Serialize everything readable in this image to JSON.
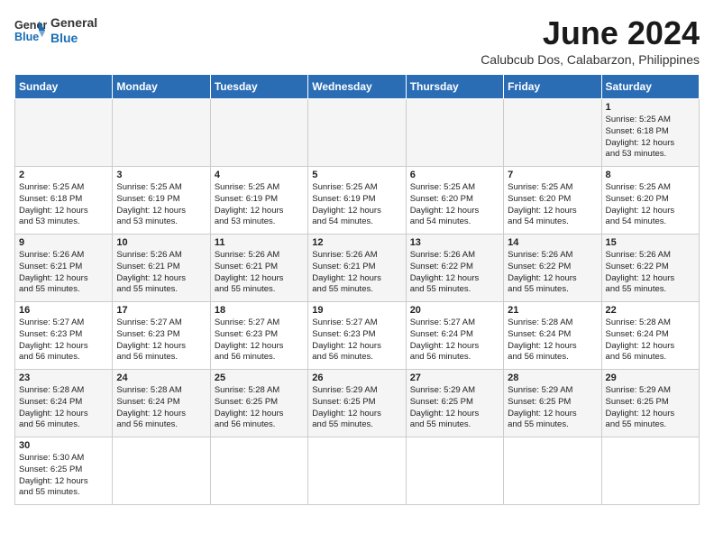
{
  "logo": {
    "text_general": "General",
    "text_blue": "Blue"
  },
  "title": "June 2024",
  "location": "Calubcub Dos, Calabarzon, Philippines",
  "days_of_week": [
    "Sunday",
    "Monday",
    "Tuesday",
    "Wednesday",
    "Thursday",
    "Friday",
    "Saturday"
  ],
  "weeks": [
    [
      {
        "day": "",
        "info": ""
      },
      {
        "day": "",
        "info": ""
      },
      {
        "day": "",
        "info": ""
      },
      {
        "day": "",
        "info": ""
      },
      {
        "day": "",
        "info": ""
      },
      {
        "day": "",
        "info": ""
      },
      {
        "day": "1",
        "info": "Sunrise: 5:25 AM\nSunset: 6:18 PM\nDaylight: 12 hours\nand 53 minutes."
      }
    ],
    [
      {
        "day": "2",
        "info": "Sunrise: 5:25 AM\nSunset: 6:18 PM\nDaylight: 12 hours\nand 53 minutes."
      },
      {
        "day": "3",
        "info": "Sunrise: 5:25 AM\nSunset: 6:19 PM\nDaylight: 12 hours\nand 53 minutes."
      },
      {
        "day": "4",
        "info": "Sunrise: 5:25 AM\nSunset: 6:19 PM\nDaylight: 12 hours\nand 53 minutes."
      },
      {
        "day": "5",
        "info": "Sunrise: 5:25 AM\nSunset: 6:19 PM\nDaylight: 12 hours\nand 54 minutes."
      },
      {
        "day": "6",
        "info": "Sunrise: 5:25 AM\nSunset: 6:20 PM\nDaylight: 12 hours\nand 54 minutes."
      },
      {
        "day": "7",
        "info": "Sunrise: 5:25 AM\nSunset: 6:20 PM\nDaylight: 12 hours\nand 54 minutes."
      },
      {
        "day": "8",
        "info": "Sunrise: 5:25 AM\nSunset: 6:20 PM\nDaylight: 12 hours\nand 54 minutes."
      }
    ],
    [
      {
        "day": "9",
        "info": "Sunrise: 5:26 AM\nSunset: 6:21 PM\nDaylight: 12 hours\nand 55 minutes."
      },
      {
        "day": "10",
        "info": "Sunrise: 5:26 AM\nSunset: 6:21 PM\nDaylight: 12 hours\nand 55 minutes."
      },
      {
        "day": "11",
        "info": "Sunrise: 5:26 AM\nSunset: 6:21 PM\nDaylight: 12 hours\nand 55 minutes."
      },
      {
        "day": "12",
        "info": "Sunrise: 5:26 AM\nSunset: 6:21 PM\nDaylight: 12 hours\nand 55 minutes."
      },
      {
        "day": "13",
        "info": "Sunrise: 5:26 AM\nSunset: 6:22 PM\nDaylight: 12 hours\nand 55 minutes."
      },
      {
        "day": "14",
        "info": "Sunrise: 5:26 AM\nSunset: 6:22 PM\nDaylight: 12 hours\nand 55 minutes."
      },
      {
        "day": "15",
        "info": "Sunrise: 5:26 AM\nSunset: 6:22 PM\nDaylight: 12 hours\nand 55 minutes."
      }
    ],
    [
      {
        "day": "16",
        "info": "Sunrise: 5:27 AM\nSunset: 6:23 PM\nDaylight: 12 hours\nand 56 minutes."
      },
      {
        "day": "17",
        "info": "Sunrise: 5:27 AM\nSunset: 6:23 PM\nDaylight: 12 hours\nand 56 minutes."
      },
      {
        "day": "18",
        "info": "Sunrise: 5:27 AM\nSunset: 6:23 PM\nDaylight: 12 hours\nand 56 minutes."
      },
      {
        "day": "19",
        "info": "Sunrise: 5:27 AM\nSunset: 6:23 PM\nDaylight: 12 hours\nand 56 minutes."
      },
      {
        "day": "20",
        "info": "Sunrise: 5:27 AM\nSunset: 6:24 PM\nDaylight: 12 hours\nand 56 minutes."
      },
      {
        "day": "21",
        "info": "Sunrise: 5:28 AM\nSunset: 6:24 PM\nDaylight: 12 hours\nand 56 minutes."
      },
      {
        "day": "22",
        "info": "Sunrise: 5:28 AM\nSunset: 6:24 PM\nDaylight: 12 hours\nand 56 minutes."
      }
    ],
    [
      {
        "day": "23",
        "info": "Sunrise: 5:28 AM\nSunset: 6:24 PM\nDaylight: 12 hours\nand 56 minutes."
      },
      {
        "day": "24",
        "info": "Sunrise: 5:28 AM\nSunset: 6:24 PM\nDaylight: 12 hours\nand 56 minutes."
      },
      {
        "day": "25",
        "info": "Sunrise: 5:28 AM\nSunset: 6:25 PM\nDaylight: 12 hours\nand 56 minutes."
      },
      {
        "day": "26",
        "info": "Sunrise: 5:29 AM\nSunset: 6:25 PM\nDaylight: 12 hours\nand 55 minutes."
      },
      {
        "day": "27",
        "info": "Sunrise: 5:29 AM\nSunset: 6:25 PM\nDaylight: 12 hours\nand 55 minutes."
      },
      {
        "day": "28",
        "info": "Sunrise: 5:29 AM\nSunset: 6:25 PM\nDaylight: 12 hours\nand 55 minutes."
      },
      {
        "day": "29",
        "info": "Sunrise: 5:29 AM\nSunset: 6:25 PM\nDaylight: 12 hours\nand 55 minutes."
      }
    ],
    [
      {
        "day": "30",
        "info": "Sunrise: 5:30 AM\nSunset: 6:25 PM\nDaylight: 12 hours\nand 55 minutes."
      },
      {
        "day": "",
        "info": ""
      },
      {
        "day": "",
        "info": ""
      },
      {
        "day": "",
        "info": ""
      },
      {
        "day": "",
        "info": ""
      },
      {
        "day": "",
        "info": ""
      },
      {
        "day": "",
        "info": ""
      }
    ]
  ]
}
